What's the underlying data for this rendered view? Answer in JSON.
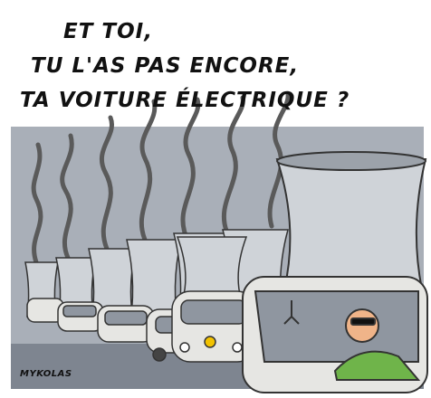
{
  "caption": {
    "line1": "ET TOI,",
    "line2": "TU L'AS PAS ENCORE,",
    "line3": "TA VOITURE ÉLECTRIQUE ?"
  },
  "signature": "MYKOLAS",
  "colors": {
    "sky": "#a9afb8",
    "tower": "#cfd3d8",
    "tower_shadow": "#9ca2aa",
    "smoke": "#5a5a5a",
    "car": "#e6e6e3",
    "window": "#8f96a0",
    "ground": "#7e8590",
    "shirt": "#6fb44a",
    "skin": "#f0b489",
    "badge": "#f2c200"
  }
}
